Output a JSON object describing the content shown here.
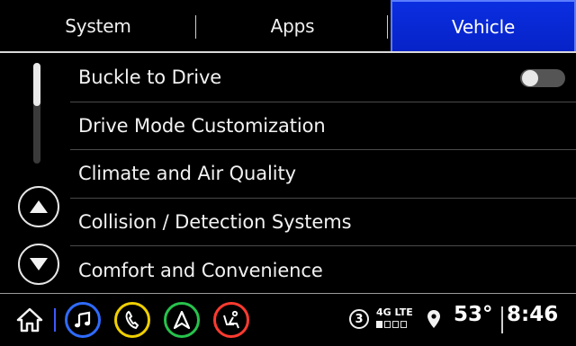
{
  "tabs": [
    {
      "label": "System",
      "active": false
    },
    {
      "label": "Apps",
      "active": false
    },
    {
      "label": "Vehicle",
      "active": true
    }
  ],
  "list": {
    "items": [
      {
        "label": "Buckle to Drive",
        "toggle": "off"
      },
      {
        "label": "Drive Mode Customization"
      },
      {
        "label": "Climate and Air Quality"
      },
      {
        "label": "Collision / Detection Systems"
      },
      {
        "label": "Comfort and Convenience"
      }
    ]
  },
  "status": {
    "notification_count": "3",
    "network": "4G LTE",
    "signal_bars_filled": 1,
    "signal_bars_total": 4,
    "temperature": "53°",
    "time": "8:46"
  },
  "icons": {
    "home": "home-icon",
    "music": "music-icon",
    "phone": "phone-icon",
    "navigation": "navigation-icon",
    "seat": "seat-icon",
    "location": "location-pin-icon",
    "scroll_up": "chevron-up-icon",
    "scroll_down": "chevron-down-icon"
  },
  "colors": {
    "active_tab": "#0723c8",
    "music": "#2f6bff",
    "phone": "#f0d000",
    "navigation": "#27c24c",
    "seat": "#ff3b30"
  }
}
